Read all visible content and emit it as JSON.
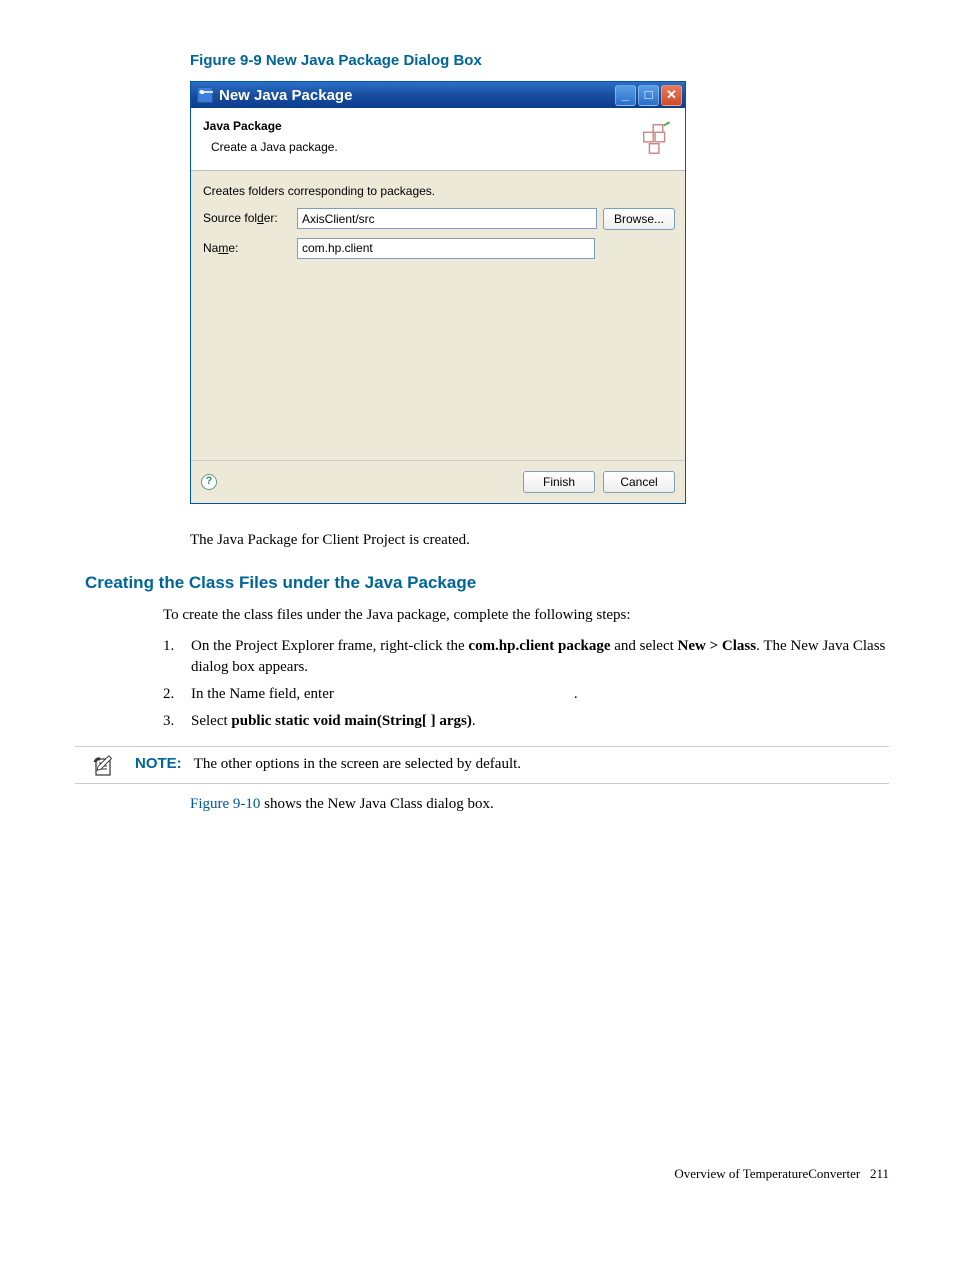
{
  "figure_caption": "Figure 9-9 New Java Package Dialog Box",
  "dialog": {
    "title": "New Java Package",
    "header_title": "Java Package",
    "header_desc": "Create a Java package.",
    "body_hint": "Creates folders corresponding to packages.",
    "source_folder_label_pre": "Source fol",
    "source_folder_label_ul": "d",
    "source_folder_label_post": "er:",
    "source_folder_value": "AxisClient/src",
    "name_label_pre": "Na",
    "name_label_ul": "m",
    "name_label_post": "e:",
    "name_value": "com.hp.client",
    "browse_pre": "Br",
    "browse_ul": "o",
    "browse_post": "wse...",
    "finish_ul": "F",
    "finish_post": "inish",
    "cancel": "Cancel",
    "help_symbol": "?"
  },
  "para_after_figure": "The Java Package for Client Project is created.",
  "section_heading": "Creating the Class Files under the Java Package",
  "intro": "To create the class files under the Java package, complete the following steps:",
  "steps": {
    "s1_num": "1.",
    "s1_a": "On the Project Explorer frame, right-click the ",
    "s1_b": "com.hp.client package",
    "s1_c": " and select ",
    "s1_d": "New > Class",
    "s1_e": ". The New Java Class dialog box appears.",
    "s2_num": "2.",
    "s2_a": "In the Name field, enter",
    "s2_b": ".",
    "s3_num": "3.",
    "s3_a": "Select ",
    "s3_b": "public static void main(String[ ] args)",
    "s3_c": "."
  },
  "note": {
    "label": "NOTE:",
    "text": "The other options in the screen are selected by default."
  },
  "after_note": {
    "link": "Figure 9-10",
    "rest": " shows the New Java Class dialog box."
  },
  "footer": {
    "text": "Overview of TemperatureConverter",
    "page": "211"
  }
}
